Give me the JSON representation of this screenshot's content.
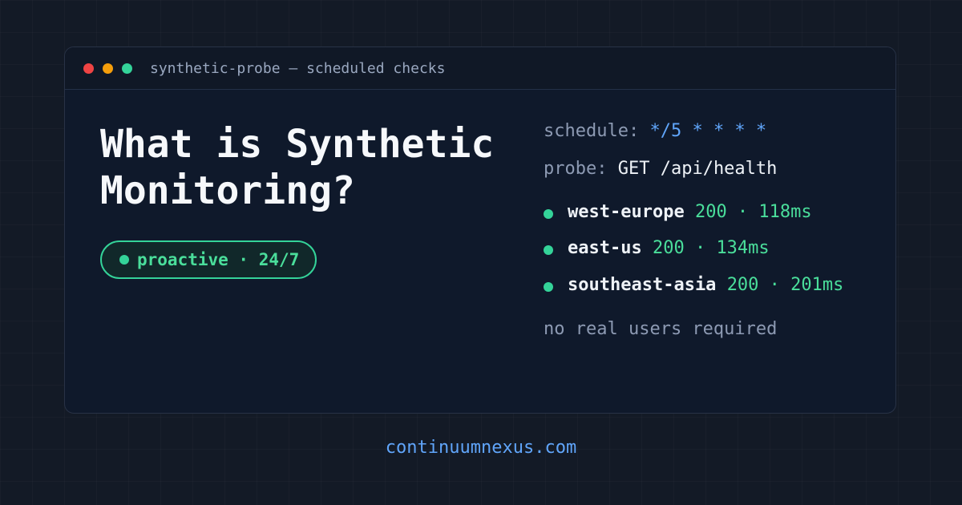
{
  "window": {
    "title": "synthetic-probe — scheduled checks"
  },
  "hero": {
    "headline": "What is Synthetic\nMonitoring?",
    "badge": "proactive · 24/7"
  },
  "config": {
    "schedule_key": "schedule:",
    "schedule_value": "*/5 * * * *",
    "probe_key": "probe:",
    "probe_value": "GET /api/health"
  },
  "regions": [
    {
      "name": "west-europe",
      "status": "200 · 118ms"
    },
    {
      "name": "east-us",
      "status": "200 · 134ms"
    },
    {
      "name": "southeast-asia",
      "status": "200 · 201ms"
    }
  ],
  "note": "no real users required",
  "footer": {
    "domain": "continuumnexus.com"
  },
  "colors": {
    "background": "#131a26",
    "panel": "#0f192b",
    "accent_green": "#34d399",
    "accent_blue": "#60a5fa",
    "close": "#ef4444",
    "minimize": "#f59e0b",
    "maximize": "#34d399"
  }
}
